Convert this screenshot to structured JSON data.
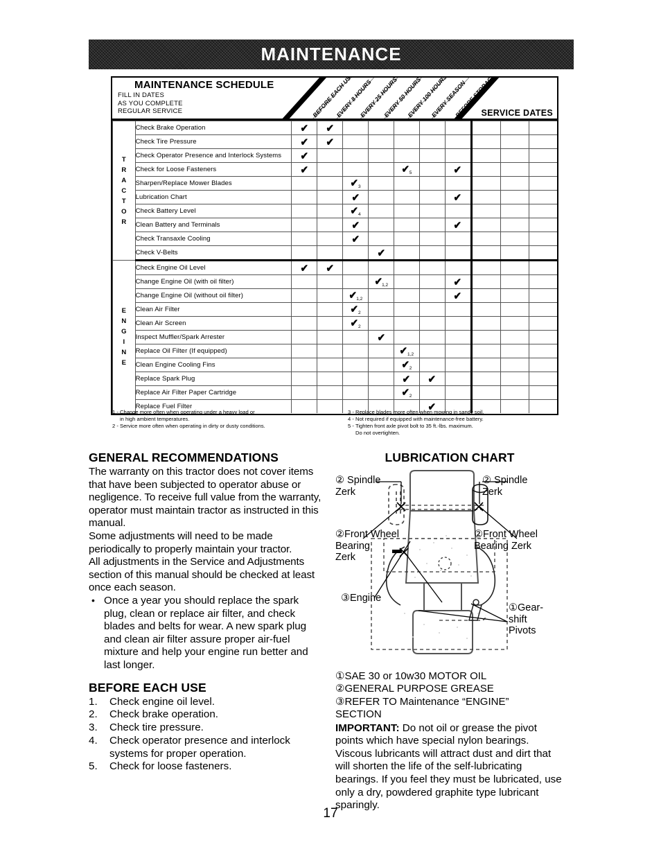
{
  "banner": {
    "title": "MAINTENANCE"
  },
  "schedule": {
    "title": "MAINTENANCE SCHEDULE",
    "subtitle_lines": [
      "FILL IN DATES",
      "AS YOU COMPLETE",
      "REGULAR SERVICE"
    ],
    "service_dates_label": "SERVICE DATES",
    "columns": [
      "BEFORE EACH USE",
      "EVERY 8 HOURS",
      "EVERY 25 HOURS",
      "EVERY 50 HOURS",
      "EVERY 100 HOURS",
      "EVERY SEASON",
      "BEFORE STORAGE"
    ],
    "check_glyph": "✔",
    "sections": [
      {
        "label": "TRACTOR",
        "rows": [
          {
            "item": "Check Brake Operation",
            "marks": [
              {
                "col": 1
              },
              {
                "col": 2
              }
            ]
          },
          {
            "item": "Check Tire Pressure",
            "marks": [
              {
                "col": 1
              },
              {
                "col": 2
              }
            ]
          },
          {
            "item": "Check Operator Presence and Interlock Systems",
            "marks": [
              {
                "col": 1
              }
            ]
          },
          {
            "item": "Check for Loose Fasteners",
            "marks": [
              {
                "col": 1
              },
              {
                "col": 5,
                "note": "5"
              },
              {
                "col": 7
              }
            ]
          },
          {
            "item": "Sharpen/Replace Mower Blades",
            "marks": [
              {
                "col": 3,
                "note": "3"
              }
            ]
          },
          {
            "item": "Lubrication Chart",
            "marks": [
              {
                "col": 3
              },
              {
                "col": 7
              }
            ]
          },
          {
            "item": "Check Battery Level",
            "marks": [
              {
                "col": 3,
                "note": "4"
              }
            ]
          },
          {
            "item": "Clean Battery and Terminals",
            "marks": [
              {
                "col": 3
              },
              {
                "col": 7
              }
            ]
          },
          {
            "item": "Check Transaxle Cooling",
            "marks": [
              {
                "col": 3
              }
            ]
          },
          {
            "item": "Check V-Belts",
            "marks": [
              {
                "col": 4
              }
            ]
          }
        ]
      },
      {
        "label": "ENGINE",
        "rows": [
          {
            "item": "Check Engine Oil Level",
            "marks": [
              {
                "col": 1
              },
              {
                "col": 2
              }
            ]
          },
          {
            "item": "Change Engine Oil (with oil filter)",
            "marks": [
              {
                "col": 4,
                "note": "1,2"
              },
              {
                "col": 7
              }
            ]
          },
          {
            "item": "Change Engine Oil (without oil filter)",
            "marks": [
              {
                "col": 3,
                "note": "1,2"
              },
              {
                "col": 7
              }
            ]
          },
          {
            "item": "Clean Air Filter",
            "marks": [
              {
                "col": 3,
                "note": "2"
              }
            ]
          },
          {
            "item": "Clean Air Screen",
            "marks": [
              {
                "col": 3,
                "note": "2"
              }
            ]
          },
          {
            "item": "Inspect Muffler/Spark Arrester",
            "marks": [
              {
                "col": 4
              }
            ]
          },
          {
            "item": "Replace Oil Filter (If equipped)",
            "marks": [
              {
                "col": 5,
                "note": "1,2"
              }
            ]
          },
          {
            "item": "Clean Engine Cooling Fins",
            "marks": [
              {
                "col": 5,
                "note": "2"
              }
            ]
          },
          {
            "item": "Replace Spark Plug",
            "marks": [
              {
                "col": 5
              },
              {
                "col": 6
              }
            ]
          },
          {
            "item": "Replace Air Filter Paper Cartridge",
            "marks": [
              {
                "col": 5,
                "note": "2"
              }
            ]
          },
          {
            "item": "Replace Fuel Filter",
            "marks": [
              {
                "col": 6
              }
            ]
          }
        ]
      }
    ],
    "footnotes_left": [
      {
        "n": "1 -",
        "text": "Change more often when operating under a heavy load or",
        "cont": "in high ambient temperatures."
      },
      {
        "n": "2 -",
        "text": "Service more often when operating in dirty or dusty conditions.",
        "cont": ""
      }
    ],
    "footnotes_right": [
      {
        "n": "3 -",
        "text": "Replace blades more often when mowing in sandy soil.",
        "cont": ""
      },
      {
        "n": "4 -",
        "text": "Not required if equipped with maintenance-free battery.",
        "cont": ""
      },
      {
        "n": "5 -",
        "text": "Tighten front axle pivot bolt to 35 ft.-lbs. maximum.",
        "cont": "Do not overtighten."
      }
    ]
  },
  "general": {
    "heading": "GENERAL RECOMMENDATIONS",
    "para1": "The warranty on this tractor does not cover items that have been subjected to operator abuse or negligence.  To receive full value from the warranty, operator must maintain tractor as instructed in this manual.",
    "para2": "Some adjustments will need to be made periodically to properly maintain your tractor.",
    "para3": "All adjustments in the Service and Adjustments section of this manual should be checked at least once each season.",
    "bullet_dot": "•",
    "bullet1": "Once a year you should replace the spark plug, clean or replace air filter, and check blades and belts for wear. A new spark plug and clean air filter assure proper air-fuel mixture and help your engine run better and last longer."
  },
  "before_each_use": {
    "heading": "BEFORE EACH USE",
    "items": [
      {
        "n": "1.",
        "text": "Check engine oil level."
      },
      {
        "n": "2.",
        "text": "Check brake operation."
      },
      {
        "n": "3.",
        "text": "Check tire pressure."
      },
      {
        "n": "4.",
        "text": "Check operator presence and interlock systems for proper operation."
      },
      {
        "n": "5.",
        "text": "Check for loose fasteners."
      }
    ]
  },
  "lubrication": {
    "heading": "LUBRICATION CHART",
    "labels": {
      "spindle_left": "② Spindle\nZerk",
      "spindle_left_l1": "② Spindle",
      "spindle_left_l2": "Zerk",
      "spindle_right_l1": "② Spindle",
      "spindle_right_l2": "Zerk",
      "front_wheel_left_l1": "②Front Wheel",
      "front_wheel_left_l2": "Bearing",
      "front_wheel_left_l3": "Zerk",
      "front_wheel_right_l1": "②Front Wheel",
      "front_wheel_right_l2": "Bearing Zerk",
      "engine": "③Engine",
      "gearshift_l1": "①Gear-",
      "gearshift_l2": "shift",
      "gearshift_l3": "Pivots"
    },
    "legend": [
      "①SAE 30 or 10w30 MOTOR OIL",
      "②GENERAL PURPOSE GREASE",
      "③REFER TO Maintenance  “ENGINE”",
      "SECTION"
    ],
    "important_label": "IMPORTANT:",
    "important_text": "  Do not oil or grease the pivot points which have special nylon bearings.  Viscous lubricants will attract dust and dirt that will shorten the life of the self-lubricating bearings.  If you feel they must be lubricated, use only a dry, powdered graphite type lubricant sparingly."
  },
  "page_number": "17"
}
